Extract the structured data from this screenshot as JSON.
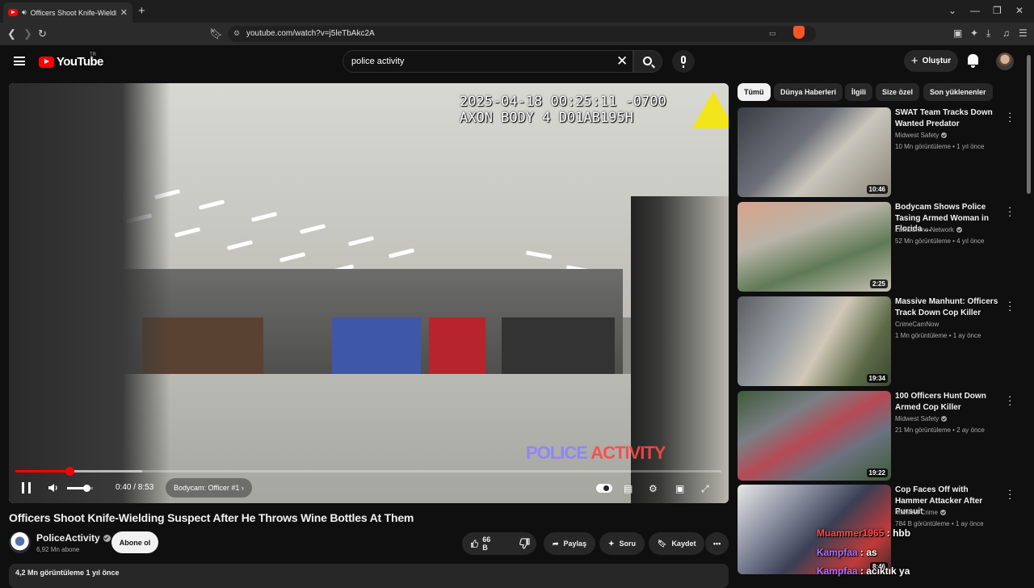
{
  "browser": {
    "tab_title": "Officers Shoot Knife-Wielding",
    "url": "youtube.com/watch?v=j5leTbAkc2A"
  },
  "header": {
    "logo_text": "YouTube",
    "country_code": "TR",
    "search_value": "police activity",
    "create_label": "Oluştur"
  },
  "player": {
    "timestamp_line1": "2025-04-18 00:25:11 -0700",
    "timestamp_line2": "AXON BODY 4 D01AB195H",
    "watermark_part1": "POLICE",
    "watermark_part2": "ACTIVITY",
    "time_display": "0:40 / 8:53",
    "chapter_label": "Bodycam: Officer #1",
    "progress_played": 0.077,
    "progress_buffered": 0.18,
    "volume_level": 0.75
  },
  "video": {
    "title": "Officers Shoot Knife-Wielding Suspect After He Throws Wine Bottles At Them",
    "channel_name": "PoliceActivity",
    "subscribers": "6,92 Mn abone",
    "subscribe_label": "Abone ol",
    "likes": "66 B",
    "share_label": "Paylaş",
    "ask_label": "Soru",
    "save_label": "Kaydet",
    "views_and_date": "4,2 Mn görüntüleme  1 yıl önce"
  },
  "chips": [
    "Tümü",
    "Dünya Haberleri",
    "İlgili",
    "Size özel",
    "Son yüklenenler"
  ],
  "recommendations": [
    {
      "title": "SWAT Team Tracks Down Wanted Predator",
      "channel": "Midwest Safety",
      "meta": "10 Mn görüntüleme • 1 yıl önce",
      "duration": "10:46",
      "verified": true
    },
    {
      "title": "Bodycam Shows Police Tasing Armed Woman in Florida ...",
      "channel": "Law&Crime Network",
      "meta": "52 Mn görüntüleme • 4 yıl önce",
      "duration": "2:25",
      "verified": true
    },
    {
      "title": "Massive Manhunt: Officers Track Down Cop Killer",
      "channel": "CrimeCamNow",
      "meta": "1 Mn görüntüleme • 1 ay önce",
      "duration": "19:34",
      "verified": false
    },
    {
      "title": "100 Officers Hunt Down Armed Cop Killer",
      "channel": "Midwest Safety",
      "meta": "21 Mn görüntüleme • 2 ay önce",
      "duration": "19:22",
      "verified": true
    },
    {
      "title": "Cop Faces Off with Hammer Attacker After Pursuit",
      "channel": "Midwest Crime",
      "meta": "784 B görüntüleme • 1 ay önce",
      "duration": "8:46",
      "verified": true
    }
  ],
  "chat_overlay": [
    {
      "user": "Muammer1965",
      "message": ": hbb"
    },
    {
      "user": "Kampfaa",
      "message": ": as"
    },
    {
      "user": "Kampfaa",
      "message": ": acıktık ya"
    }
  ]
}
